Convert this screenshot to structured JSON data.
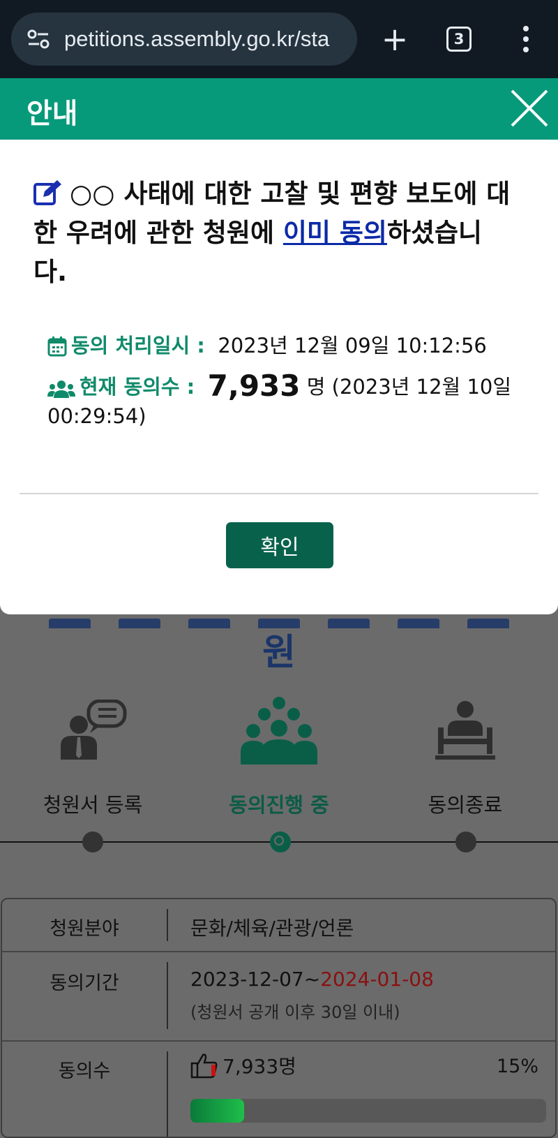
{
  "browser": {
    "url": "petitions.assembly.go.kr/sta",
    "tab_count": "3",
    "new_tab_label": "+"
  },
  "modal": {
    "title": "안내",
    "message_prefix": "○○ 사태에 대한 고찰 및 편향 보도에 대한 우려에 관한 청원에 ",
    "message_link": "이미 동의",
    "message_suffix": "하셨습니다.",
    "agree_time_label": "동의 처리일시 :",
    "agree_time_value": "2023년 12월 09일 10:12:56",
    "current_count_label": "현재 동의수 :",
    "current_count_value": "7,933",
    "current_count_unit": "명",
    "current_count_time": "(2023년 12월 10일 00:29:54)",
    "confirm_label": "확인"
  },
  "page": {
    "title_tail": "원",
    "steps": [
      {
        "label": "청원서 등록",
        "active": false
      },
      {
        "label": "동의진행 중",
        "active": true
      },
      {
        "label": "동의종료",
        "active": false
      }
    ],
    "table": {
      "field_label": "청원분야",
      "field_value": "문화/체육/관광/언론",
      "period_label": "동의기간",
      "period_start": "2023-12-07~",
      "period_end": "2024-01-08",
      "period_note": "(청원서 공개 이후 30일 이내)",
      "count_label": "동의수",
      "count_value": "7,933명",
      "count_percent": "15%",
      "progress": 0.15
    }
  },
  "colors": {
    "header_green": "#079a7a",
    "button_green": "#08614b",
    "link_blue": "#0b2aa8",
    "deadline_red": "#8a1010"
  }
}
